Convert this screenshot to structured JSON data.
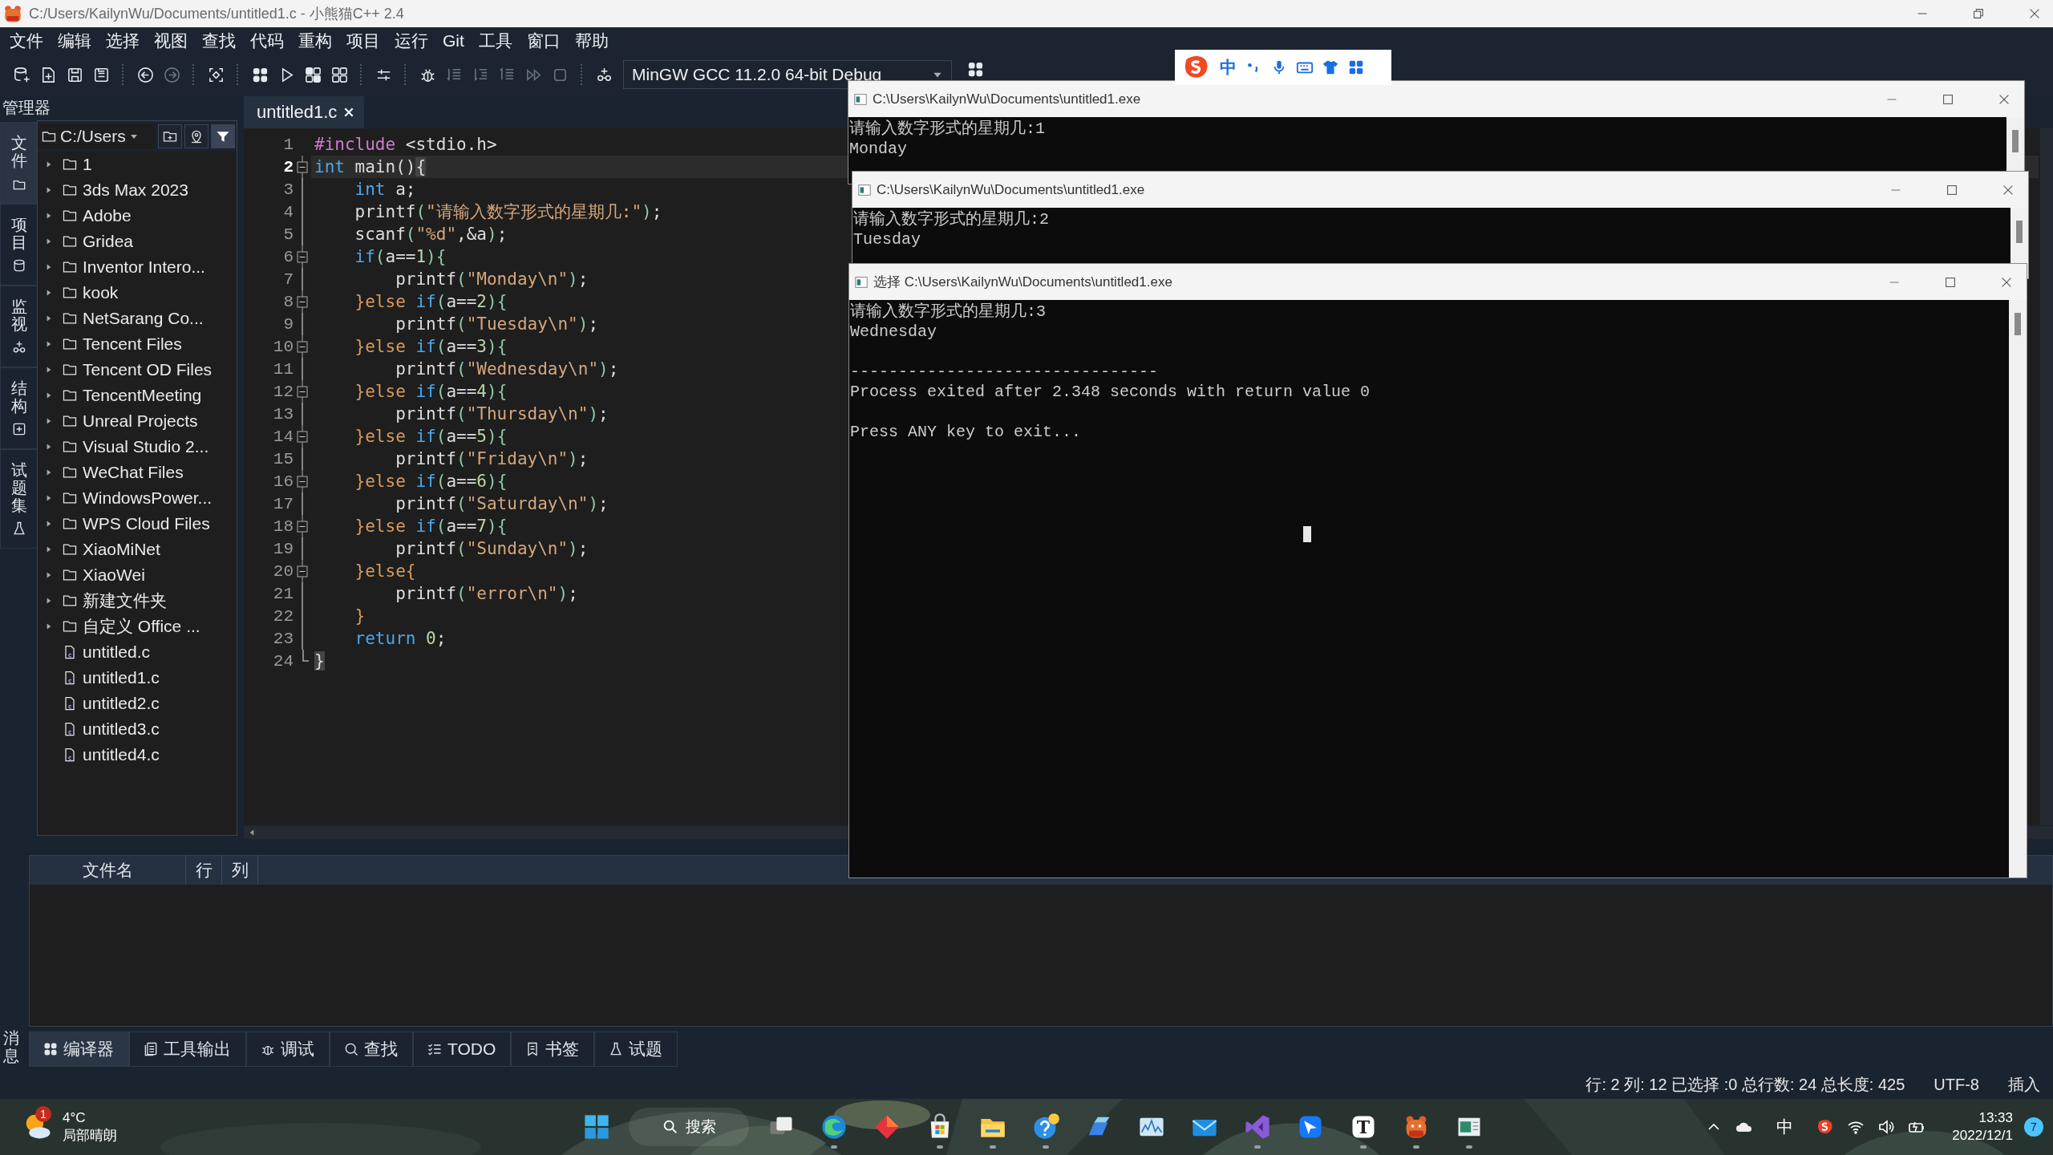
{
  "window": {
    "title": "C:/Users/KailynWu/Documents/untitled1.c - 小熊猫C++ 2.4"
  },
  "menu": [
    "文件",
    "编辑",
    "选择",
    "视图",
    "查找",
    "代码",
    "重构",
    "项目",
    "运行",
    "Git",
    "工具",
    "窗口",
    "帮助"
  ],
  "toolbar": {
    "left_buttons": [
      {
        "disabled": false
      },
      {
        "disabled": false
      },
      {
        "disabled": false
      },
      {
        "disabled": false
      },
      {
        "disabled": false
      },
      {
        "disabled": true
      },
      {
        "disabled": false
      },
      {
        "disabled": false
      },
      {
        "disabled": false
      },
      {
        "disabled": false
      },
      {
        "disabled": false
      },
      {
        "disabled": false
      },
      {
        "disabled": false
      },
      {
        "disabled": true
      },
      {
        "disabled": true
      },
      {
        "disabled": true
      },
      {
        "disabled": true
      },
      {
        "disabled": true
      },
      {
        "disabled": false
      }
    ],
    "compiler": "MinGW GCC 11.2.0 64-bit Debug",
    "right_buttons": [
      {
        "disabled": false
      }
    ]
  },
  "ime_bar": {
    "mode": "中"
  },
  "explorer": {
    "title": "管理器",
    "path": "C:/Users",
    "side_tabs": [
      {
        "label": "文件",
        "selected": true
      },
      {
        "label": "项目",
        "selected": false
      },
      {
        "label": "监视",
        "selected": false
      },
      {
        "label": "结构",
        "selected": false
      },
      {
        "label": "试题集",
        "selected": false
      }
    ],
    "items": [
      {
        "kind": "folder",
        "name": "1"
      },
      {
        "kind": "folder",
        "name": "3ds Max 2023"
      },
      {
        "kind": "folder",
        "name": "Adobe"
      },
      {
        "kind": "folder",
        "name": "Gridea"
      },
      {
        "kind": "folder",
        "name": "Inventor Intero..."
      },
      {
        "kind": "folder",
        "name": "kook"
      },
      {
        "kind": "folder",
        "name": "NetSarang Co..."
      },
      {
        "kind": "folder",
        "name": "Tencent Files"
      },
      {
        "kind": "folder",
        "name": "Tencent OD Files"
      },
      {
        "kind": "folder",
        "name": "TencentMeeting"
      },
      {
        "kind": "folder",
        "name": "Unreal Projects"
      },
      {
        "kind": "folder",
        "name": "Visual Studio 2..."
      },
      {
        "kind": "folder",
        "name": "WeChat Files"
      },
      {
        "kind": "folder",
        "name": "WindowsPower..."
      },
      {
        "kind": "folder",
        "name": "WPS Cloud Files"
      },
      {
        "kind": "folder",
        "name": "XiaoMiNet"
      },
      {
        "kind": "folder",
        "name": "XiaoWei"
      },
      {
        "kind": "folder",
        "name": "新建文件夹"
      },
      {
        "kind": "folder",
        "name": "自定义 Office ..."
      },
      {
        "kind": "file",
        "name": "untitled.c"
      },
      {
        "kind": "file",
        "name": "untitled1.c"
      },
      {
        "kind": "file",
        "name": "untitled2.c"
      },
      {
        "kind": "file",
        "name": "untitled3.c"
      },
      {
        "kind": "file",
        "name": "untitled4.c"
      }
    ]
  },
  "editor": {
    "tabs": [
      {
        "label": "untitled1.c",
        "selected": true
      }
    ],
    "lines": [
      {
        "number": "1",
        "current": false,
        "fold": false,
        "tokens": [
          {
            "kind": "pre",
            "text": "#include"
          },
          {
            "kind": "plain",
            "text": " <stdio.h>"
          }
        ]
      },
      {
        "number": "2",
        "current": true,
        "fold": true,
        "tokens": [
          {
            "kind": "kw",
            "text": "int"
          },
          {
            "kind": "plain",
            "text": " main()"
          },
          {
            "kind": "brace",
            "text": "{"
          }
        ]
      },
      {
        "number": "3",
        "current": false,
        "fold": false,
        "tokens": [
          {
            "kind": "kw",
            "text": "    int"
          },
          {
            "kind": "plain",
            "text": " a;"
          }
        ]
      },
      {
        "number": "4",
        "current": false,
        "fold": false,
        "tokens": [
          {
            "kind": "plain",
            "text": "    printf"
          },
          {
            "kind": "punc",
            "text": "("
          },
          {
            "kind": "str",
            "text": "\"请输入数字形式的星期几:\""
          },
          {
            "kind": "punc",
            "text": ")"
          },
          {
            "kind": "plain",
            "text": ";"
          }
        ]
      },
      {
        "number": "5",
        "current": false,
        "fold": false,
        "tokens": [
          {
            "kind": "plain",
            "text": "    scanf"
          },
          {
            "kind": "punc",
            "text": "("
          },
          {
            "kind": "str",
            "text": "\"%d\""
          },
          {
            "kind": "plain",
            "text": ",&a"
          },
          {
            "kind": "punc",
            "text": ")"
          },
          {
            "kind": "plain",
            "text": ";"
          }
        ]
      },
      {
        "number": "6",
        "current": false,
        "fold": true,
        "tokens": [
          {
            "kind": "kw",
            "text": "    if"
          },
          {
            "kind": "punc",
            "text": "("
          },
          {
            "kind": "plain",
            "text": "a=="
          },
          {
            "kind": "num",
            "text": "1"
          },
          {
            "kind": "punc",
            "text": "){"
          }
        ]
      },
      {
        "number": "7",
        "current": false,
        "fold": false,
        "tokens": [
          {
            "kind": "plain",
            "text": "        printf"
          },
          {
            "kind": "punc",
            "text": "("
          },
          {
            "kind": "str",
            "text": "\"Monday\\n\""
          },
          {
            "kind": "punc",
            "text": ")"
          },
          {
            "kind": "plain",
            "text": ";"
          }
        ]
      },
      {
        "number": "8",
        "current": false,
        "fold": true,
        "tokens": [
          {
            "kind": "ctrl",
            "text": "    }else "
          },
          {
            "kind": "kw",
            "text": "if"
          },
          {
            "kind": "punc",
            "text": "("
          },
          {
            "kind": "plain",
            "text": "a=="
          },
          {
            "kind": "num",
            "text": "2"
          },
          {
            "kind": "punc",
            "text": "){"
          }
        ]
      },
      {
        "number": "9",
        "current": false,
        "fold": false,
        "tokens": [
          {
            "kind": "plain",
            "text": "        printf"
          },
          {
            "kind": "punc",
            "text": "("
          },
          {
            "kind": "str",
            "text": "\"Tuesday\\n\""
          },
          {
            "kind": "punc",
            "text": ")"
          },
          {
            "kind": "plain",
            "text": ";"
          }
        ]
      },
      {
        "number": "10",
        "current": false,
        "fold": true,
        "tokens": [
          {
            "kind": "ctrl",
            "text": "    }else "
          },
          {
            "kind": "kw",
            "text": "if"
          },
          {
            "kind": "punc",
            "text": "("
          },
          {
            "kind": "plain",
            "text": "a=="
          },
          {
            "kind": "num",
            "text": "3"
          },
          {
            "kind": "punc",
            "text": "){"
          }
        ]
      },
      {
        "number": "11",
        "current": false,
        "fold": false,
        "tokens": [
          {
            "kind": "plain",
            "text": "        printf"
          },
          {
            "kind": "punc",
            "text": "("
          },
          {
            "kind": "str",
            "text": "\"Wednesday\\n\""
          },
          {
            "kind": "punc",
            "text": ")"
          },
          {
            "kind": "plain",
            "text": ";"
          }
        ]
      },
      {
        "number": "12",
        "current": false,
        "fold": true,
        "tokens": [
          {
            "kind": "ctrl",
            "text": "    }else "
          },
          {
            "kind": "kw",
            "text": "if"
          },
          {
            "kind": "punc",
            "text": "("
          },
          {
            "kind": "plain",
            "text": "a=="
          },
          {
            "kind": "num",
            "text": "4"
          },
          {
            "kind": "punc",
            "text": "){"
          }
        ]
      },
      {
        "number": "13",
        "current": false,
        "fold": false,
        "tokens": [
          {
            "kind": "plain",
            "text": "        printf"
          },
          {
            "kind": "punc",
            "text": "("
          },
          {
            "kind": "str",
            "text": "\"Thursday\\n\""
          },
          {
            "kind": "punc",
            "text": ")"
          },
          {
            "kind": "plain",
            "text": ";"
          }
        ]
      },
      {
        "number": "14",
        "current": false,
        "fold": true,
        "tokens": [
          {
            "kind": "ctrl",
            "text": "    }else "
          },
          {
            "kind": "kw",
            "text": "if"
          },
          {
            "kind": "punc",
            "text": "("
          },
          {
            "kind": "plain",
            "text": "a=="
          },
          {
            "kind": "num",
            "text": "5"
          },
          {
            "kind": "punc",
            "text": "){"
          }
        ]
      },
      {
        "number": "15",
        "current": false,
        "fold": false,
        "tokens": [
          {
            "kind": "plain",
            "text": "        printf"
          },
          {
            "kind": "punc",
            "text": "("
          },
          {
            "kind": "str",
            "text": "\"Friday\\n\""
          },
          {
            "kind": "punc",
            "text": ")"
          },
          {
            "kind": "plain",
            "text": ";"
          }
        ]
      },
      {
        "number": "16",
        "current": false,
        "fold": true,
        "tokens": [
          {
            "kind": "ctrl",
            "text": "    }else "
          },
          {
            "kind": "kw",
            "text": "if"
          },
          {
            "kind": "punc",
            "text": "("
          },
          {
            "kind": "plain",
            "text": "a=="
          },
          {
            "kind": "num",
            "text": "6"
          },
          {
            "kind": "punc",
            "text": "){"
          }
        ]
      },
      {
        "number": "17",
        "current": false,
        "fold": false,
        "tokens": [
          {
            "kind": "plain",
            "text": "        printf"
          },
          {
            "kind": "punc",
            "text": "("
          },
          {
            "kind": "str",
            "text": "\"Saturday\\n\""
          },
          {
            "kind": "punc",
            "text": ")"
          },
          {
            "kind": "plain",
            "text": ";"
          }
        ]
      },
      {
        "number": "18",
        "current": false,
        "fold": true,
        "tokens": [
          {
            "kind": "ctrl",
            "text": "    }else "
          },
          {
            "kind": "kw",
            "text": "if"
          },
          {
            "kind": "punc",
            "text": "("
          },
          {
            "kind": "plain",
            "text": "a=="
          },
          {
            "kind": "num",
            "text": "7"
          },
          {
            "kind": "punc",
            "text": "){"
          }
        ]
      },
      {
        "number": "19",
        "current": false,
        "fold": false,
        "tokens": [
          {
            "kind": "plain",
            "text": "        printf"
          },
          {
            "kind": "punc",
            "text": "("
          },
          {
            "kind": "str",
            "text": "\"Sunday\\n\""
          },
          {
            "kind": "punc",
            "text": ")"
          },
          {
            "kind": "plain",
            "text": ";"
          }
        ]
      },
      {
        "number": "20",
        "current": false,
        "fold": true,
        "tokens": [
          {
            "kind": "ctrl",
            "text": "    }else{"
          }
        ]
      },
      {
        "number": "21",
        "current": false,
        "fold": false,
        "tokens": [
          {
            "kind": "plain",
            "text": "        printf"
          },
          {
            "kind": "punc",
            "text": "("
          },
          {
            "kind": "str",
            "text": "\"error\\n\""
          },
          {
            "kind": "punc",
            "text": ")"
          },
          {
            "kind": "plain",
            "text": ";"
          }
        ]
      },
      {
        "number": "22",
        "current": false,
        "fold": false,
        "tokens": [
          {
            "kind": "ctrl",
            "text": "    }"
          }
        ]
      },
      {
        "number": "23",
        "current": false,
        "fold": false,
        "tokens": [
          {
            "kind": "kw",
            "text": "    return"
          },
          {
            "kind": "num",
            "text": " 0"
          },
          {
            "kind": "plain",
            "text": ";"
          }
        ]
      },
      {
        "number": "24",
        "current": false,
        "fold": false,
        "tokens": [
          {
            "kind": "brace",
            "text": "}"
          }
        ]
      }
    ]
  },
  "consoles": [
    {
      "title": "C:\\Users\\KailynWu\\Documents\\untitled1.exe",
      "blocks": [
        [
          "请输入数字形式的星期几:1",
          "Monday"
        ]
      ]
    },
    {
      "title": "C:\\Users\\KailynWu\\Documents\\untitled1.exe",
      "blocks": [
        [
          "请输入数字形式的星期几:2",
          "Tuesday"
        ]
      ]
    },
    {
      "title": "选择 C:\\Users\\KailynWu\\Documents\\untitled1.exe",
      "blocks": [
        [
          "请输入数字形式的星期几:3",
          "Wednesday"
        ],
        [
          "--------------------------------",
          "Process exited after 2.348 seconds with return value 0"
        ],
        [
          "Press ANY key to exit..."
        ]
      ]
    }
  ],
  "messages": {
    "label": "消息",
    "columns": [
      "文件名",
      "行",
      "列"
    ],
    "tabs": [
      {
        "label": "编译器",
        "selected": true
      },
      {
        "label": "工具输出",
        "selected": false
      },
      {
        "label": "调试",
        "selected": false
      },
      {
        "label": "查找",
        "selected": false
      },
      {
        "label": "TODO",
        "selected": false
      },
      {
        "label": "书签",
        "selected": false
      },
      {
        "label": "试题",
        "selected": false
      }
    ]
  },
  "status_bar": {
    "position": "行: 2 列: 12 已选择 :0 总行数: 24 总长度: 425",
    "encoding": "UTF-8",
    "mode": "插入"
  },
  "taskbar": {
    "weather": {
      "badge": "1",
      "temperature": "4°C",
      "condition": "局部晴朗"
    },
    "search": "搜索",
    "apps": [
      {
        "running": true
      },
      {
        "running": false
      },
      {
        "running": true
      },
      {
        "running": true
      },
      {
        "running": true
      },
      {
        "running": false
      },
      {
        "running": false
      },
      {
        "running": false
      },
      {
        "running": true
      },
      {
        "running": false
      },
      {
        "running": true,
        "glyph": "T"
      },
      {
        "running": true
      },
      {
        "running": true
      }
    ],
    "tray": {
      "ime": "中"
    },
    "clock": {
      "time": "13:33",
      "date": "2022/12/1"
    },
    "notifications": "7"
  }
}
